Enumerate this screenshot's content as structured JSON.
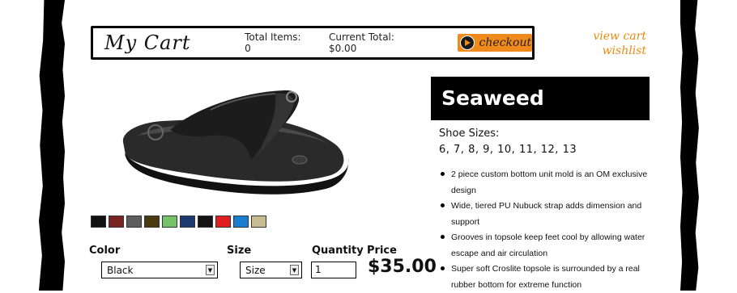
{
  "cart": {
    "title": "My Cart",
    "total_items": "Total Items: 0",
    "current_total": "Current Total: $0.00",
    "checkout_label": "checkout"
  },
  "links": {
    "view_cart": "view cart",
    "wishlist": "wishlist"
  },
  "product": {
    "name": "Seaweed",
    "sizes_label": "Shoe Sizes:",
    "sizes": "6, 7, 8, 9, 10, 11, 12, 13",
    "price": "$35.00",
    "features": [
      "2 piece custom bottom unit mold is an OM exclusive design",
      "Wide, tiered PU Nubuck strap adds dimension and support",
      "Grooves in topsole keep feet cool by allowing water escape and air circulation",
      "Super soft Croslite topsole is surrounded by a real rubber bottom for extreme function"
    ]
  },
  "swatches": [
    "#111111",
    "#7a2323",
    "#5e5e5e",
    "#4a3a10",
    "#74c26a",
    "#1d3a6e",
    "#141414",
    "#e02020",
    "#1a7fd0",
    "#c8bb90"
  ],
  "options": {
    "color_label": "Color",
    "color_value": "Black",
    "size_label": "Size",
    "size_value": "Size",
    "quantity_label": "Quantity",
    "quantity_value": "1",
    "price_label": "Price"
  },
  "accent_color": "#f08a1c"
}
